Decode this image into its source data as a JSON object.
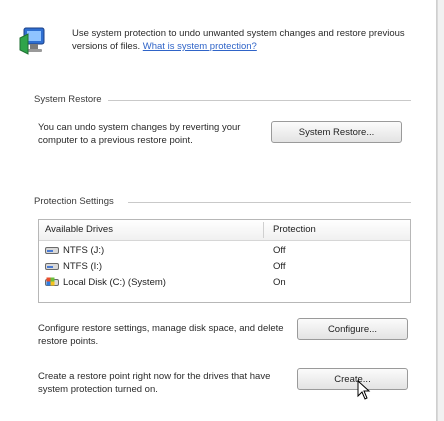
{
  "header": {
    "text": "Use system protection to undo unwanted system changes and restore previous versions of files.",
    "link": "What is system protection?"
  },
  "system_restore": {
    "title": "System Restore",
    "description": "You can undo system changes by reverting your computer to a previous restore point.",
    "button": "System Restore..."
  },
  "protection_settings": {
    "title": "Protection Settings",
    "columns": [
      "Available Drives",
      "Protection"
    ],
    "drives": [
      {
        "name": "NTFS (J:)",
        "protection": "Off",
        "icon": "drive-icon"
      },
      {
        "name": "NTFS (I:)",
        "protection": "Off",
        "icon": "drive-icon"
      },
      {
        "name": "Local Disk (C:) (System)",
        "protection": "On",
        "icon": "system-drive-icon"
      }
    ],
    "configure_text": "Configure restore settings, manage disk space, and delete restore points.",
    "configure_button": "Configure...",
    "create_text": "Create a restore point right now for the drives that have system protection turned on.",
    "create_button": "Create..."
  }
}
